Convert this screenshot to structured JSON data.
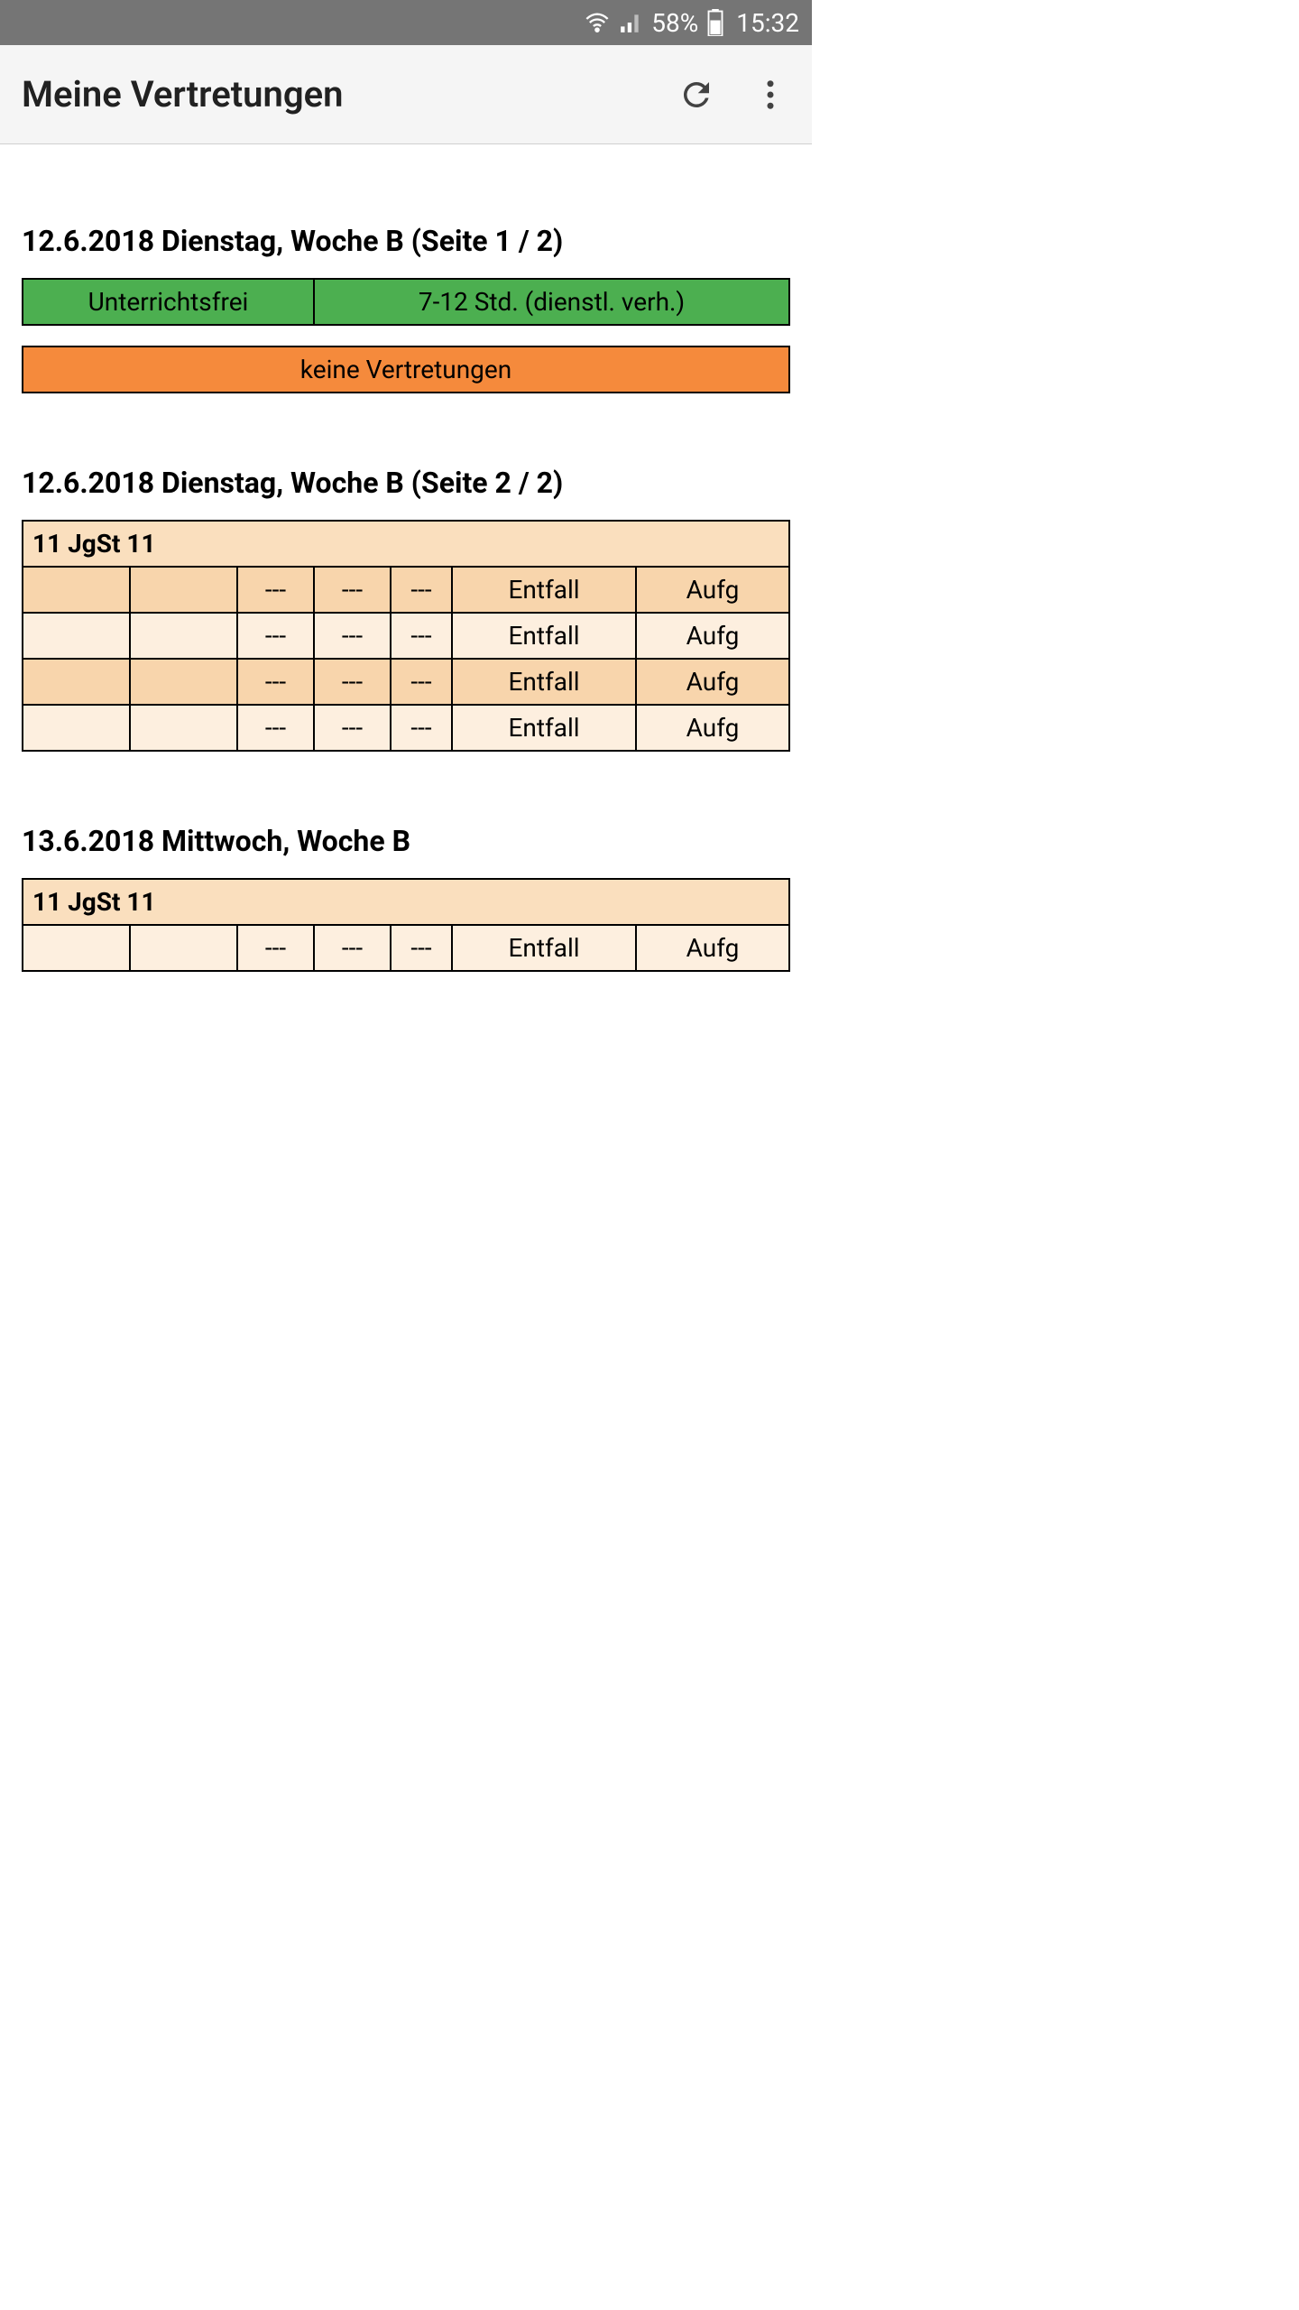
{
  "status": {
    "battery_pct": "58%",
    "time": "15:32"
  },
  "header": {
    "title": "Meine Vertretungen"
  },
  "sections": [
    {
      "title": "12.6.2018 Dienstag, Woche B (Seite 1 / 2)",
      "info_row": {
        "left": "Unterrichtsfrei",
        "right": "7-12 Std. (dienstl. verh.)"
      },
      "notice": "keine Vertretungen"
    },
    {
      "title": "12.6.2018 Dienstag, Woche B (Seite 2 / 2)",
      "table_header": "11 JgSt 11",
      "rows": [
        {
          "c1": "",
          "c2": "",
          "c3": "---",
          "c4": "---",
          "c5": "---",
          "c6": "Entfall",
          "c7": "Aufg"
        },
        {
          "c1": "",
          "c2": "",
          "c3": "---",
          "c4": "---",
          "c5": "---",
          "c6": "Entfall",
          "c7": "Aufg"
        },
        {
          "c1": "",
          "c2": "",
          "c3": "---",
          "c4": "---",
          "c5": "---",
          "c6": "Entfall",
          "c7": "Aufg"
        },
        {
          "c1": "",
          "c2": "",
          "c3": "---",
          "c4": "---",
          "c5": "---",
          "c6": "Entfall",
          "c7": "Aufg"
        }
      ]
    },
    {
      "title": "13.6.2018 Mittwoch, Woche B",
      "table_header": "11 JgSt 11",
      "rows": [
        {
          "c1": "",
          "c2": "",
          "c3": "---",
          "c4": "---",
          "c5": "---",
          "c6": "Entfall",
          "c7": "Aufg"
        }
      ]
    }
  ]
}
